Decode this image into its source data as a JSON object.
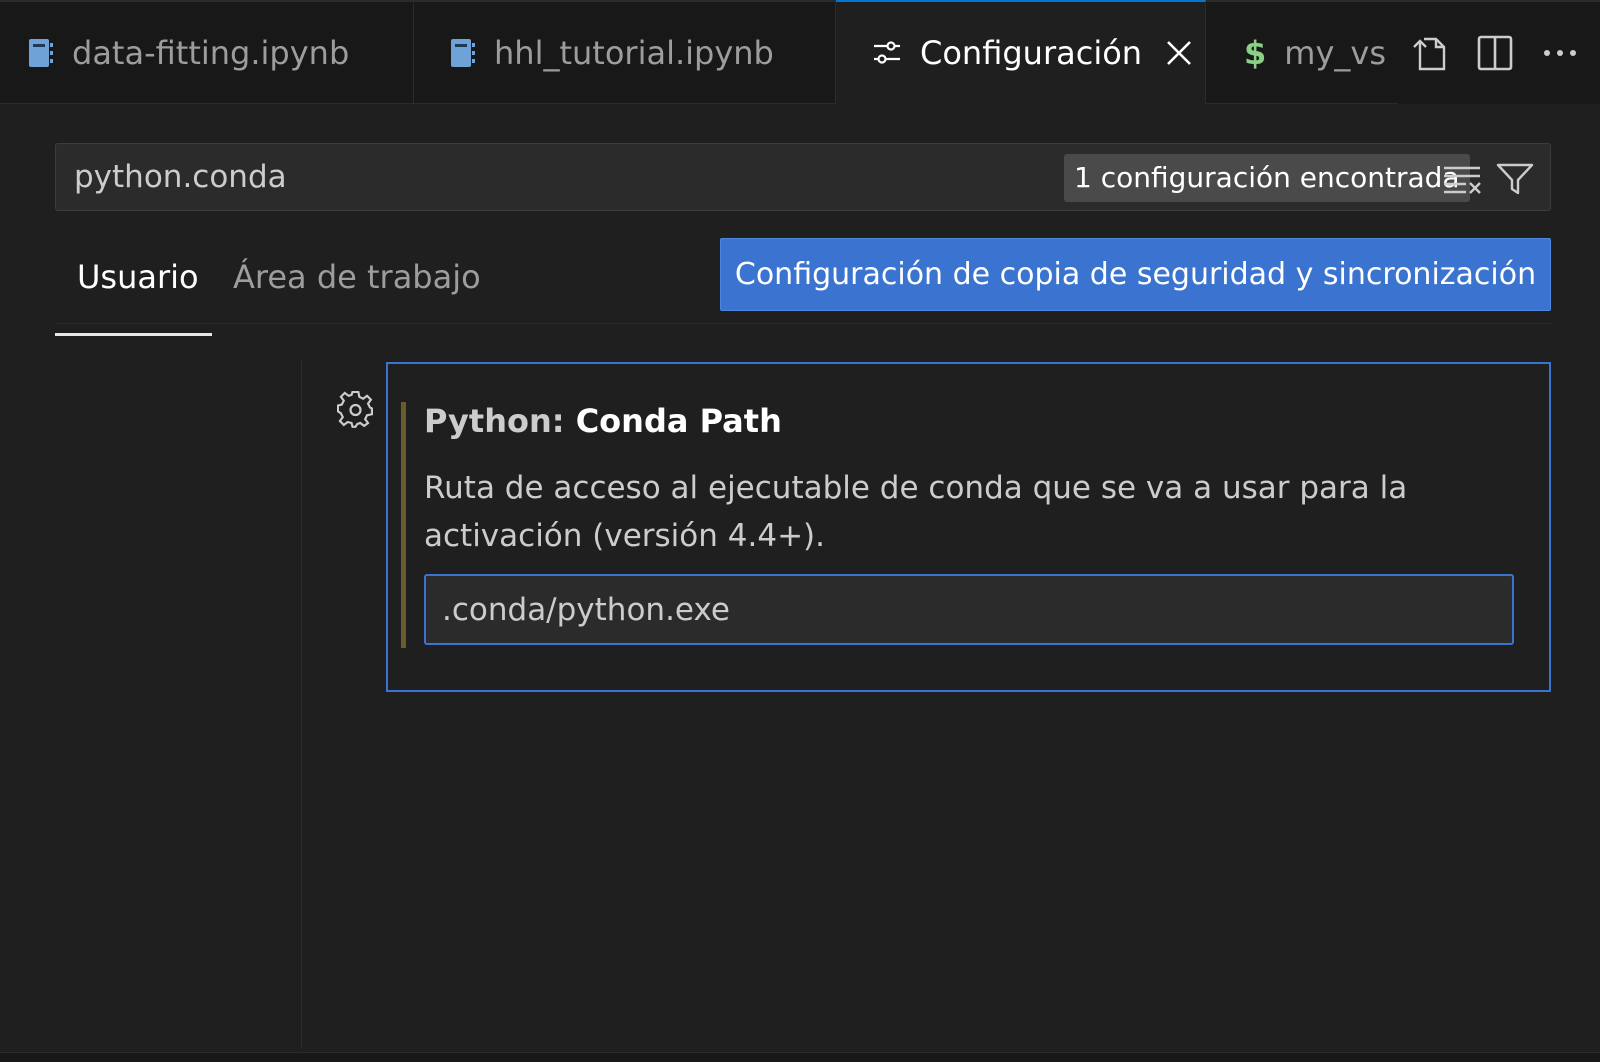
{
  "tabs": [
    {
      "label": "data-fitting.ipynb",
      "icon": "notebook-icon",
      "active": false
    },
    {
      "label": "hhl_tutorial.ipynb",
      "icon": "notebook-icon",
      "active": false
    },
    {
      "label": "Configuración",
      "icon": "settings-sliders-icon",
      "active": true
    },
    {
      "label": "my_vs",
      "icon": "dollar-icon",
      "active": false
    }
  ],
  "tab_actions": [
    "open-file-icon",
    "split-editor-icon",
    "more-actions-icon"
  ],
  "search": {
    "value": "python.conda",
    "result_count": "1 configuración encontrada"
  },
  "scope_tabs": {
    "user": "Usuario",
    "workspace": "Área de trabajo"
  },
  "sync_button": "Configuración de copia de seguridad y sincronización",
  "setting": {
    "category": "Python: ",
    "name": "Conda Path",
    "description": "Ruta de acceso al ejecutable de conda que se va a usar para la activación (versión 4.4+).",
    "value": ".conda/python.exe"
  },
  "colors": {
    "accent": "#3a74d0",
    "tab_active_border": "#0078d4",
    "modified_indicator": "#6b5a2a",
    "dollar": "#89d185",
    "notebook_icon": "#6fa3d8"
  }
}
